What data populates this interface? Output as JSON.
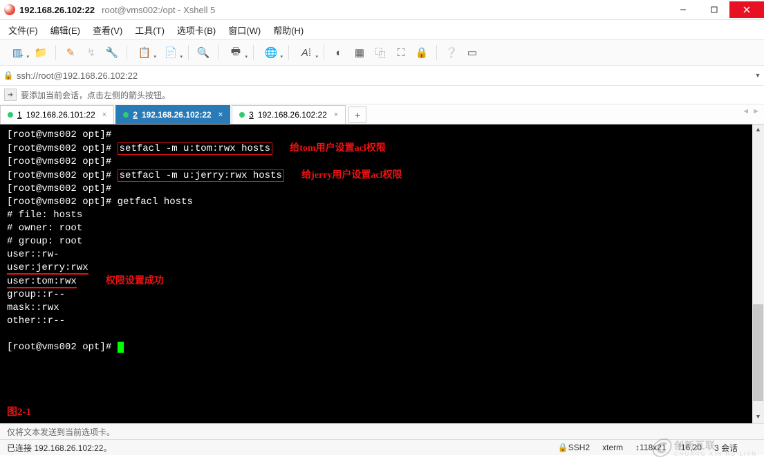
{
  "title": {
    "primary": "192.168.26.102:22",
    "secondary": "root@vms002:/opt - Xshell 5"
  },
  "menus": {
    "file": "文件(F)",
    "edit": "编辑(E)",
    "view": "查看(V)",
    "tools": "工具(T)",
    "tab": "选项卡(B)",
    "window": "窗口(W)",
    "help": "帮助(H)"
  },
  "address": "ssh://root@192.168.26.102:22",
  "infobar": "要添加当前会话，点击左侧的箭头按钮。",
  "tabs": [
    {
      "num": "1",
      "label": "192.168.26.101:22",
      "active": false
    },
    {
      "num": "2",
      "label": "192.168.26.102:22",
      "active": true
    },
    {
      "num": "3",
      "label": "192.168.26.102:22",
      "active": false
    }
  ],
  "terminal": {
    "prompt": "[root@vms002 opt]#",
    "cmd1": "setfacl -m u:tom:rwx hosts",
    "annot1": "给tom用户设置acl权限",
    "cmd2": "setfacl -m u:jerry:rwx hosts",
    "annot2": "给jerry用户设置acl权限",
    "cmd3": "getfacl hosts",
    "out_file": "# file: hosts",
    "out_owner": "# owner: root",
    "out_group": "# group: root",
    "out_user_rw": "user::rw-",
    "out_user_jerry": "user:jerry:rwx",
    "out_user_tom": "user:tom:rwx",
    "annot3": "权限设置成功",
    "out_group_r": "group::r--",
    "out_mask": "mask::rwx",
    "out_other": "other::r--",
    "fig_label": "图2-1"
  },
  "footer": {
    "line1": "仅将文本发送到当前选项卡。",
    "status": "已连接 192.168.26.102:22。",
    "proto": "SSH2",
    "term": "xterm",
    "size": "118x21",
    "pos": "16,20",
    "sess": "3 会话"
  },
  "watermark": {
    "main": "创新互联",
    "sub": "CHUANG XIN HU LIAN"
  }
}
